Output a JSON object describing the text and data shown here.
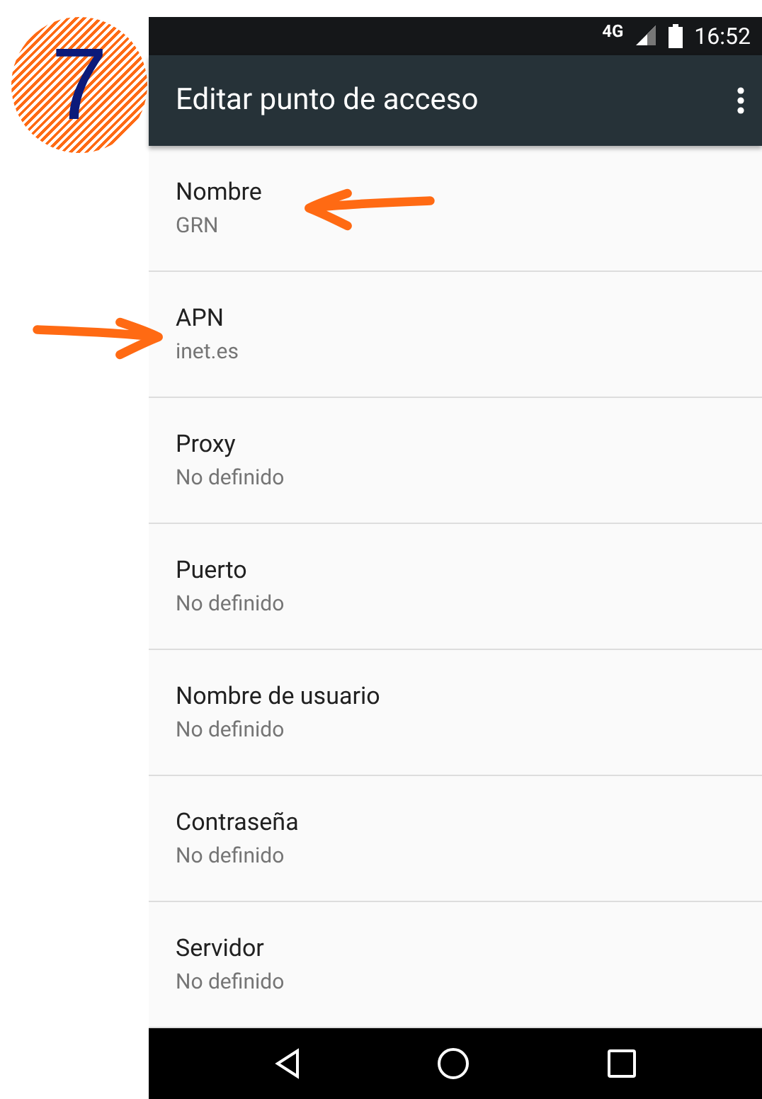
{
  "step_badge": "7",
  "status_bar": {
    "network": "4G",
    "time": "16:52"
  },
  "toolbar": {
    "title": "Editar punto de acceso"
  },
  "settings": [
    {
      "title": "Nombre",
      "value": "GRN",
      "highlighted": true
    },
    {
      "title": "APN",
      "value": "inet.es",
      "highlighted": true
    },
    {
      "title": "Proxy",
      "value": "No definido",
      "highlighted": false
    },
    {
      "title": "Puerto",
      "value": "No definido",
      "highlighted": false
    },
    {
      "title": "Nombre de usuario",
      "value": "No definido",
      "highlighted": false
    },
    {
      "title": "Contraseña",
      "value": "No definido",
      "highlighted": false
    },
    {
      "title": "Servidor",
      "value": "No definido",
      "highlighted": false
    }
  ]
}
